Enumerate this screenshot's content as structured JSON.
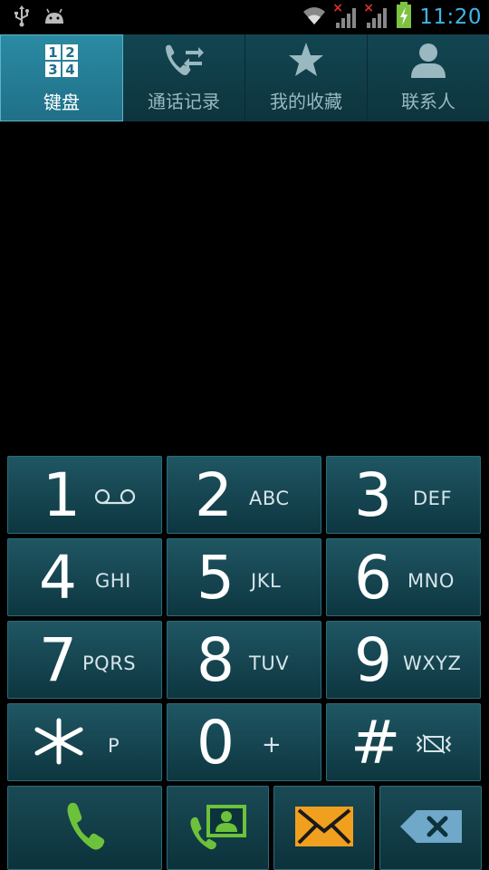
{
  "status": {
    "time": "11:20",
    "icons": [
      "usb-icon",
      "android-icon",
      "wifi-icon",
      "signal-no-sim-icon",
      "signal-no-sim-icon",
      "battery-charging-icon"
    ]
  },
  "tabs": [
    {
      "label": "键盘",
      "icon": "keypad-icon",
      "active": true
    },
    {
      "label": "通话记录",
      "icon": "call-log-icon",
      "active": false
    },
    {
      "label": "我的收藏",
      "icon": "star-icon",
      "active": false
    },
    {
      "label": "联系人",
      "icon": "person-icon",
      "active": false
    }
  ],
  "keypad": {
    "k1": {
      "digit": "1",
      "letters": ""
    },
    "k2": {
      "digit": "2",
      "letters": "ABC"
    },
    "k3": {
      "digit": "3",
      "letters": "DEF"
    },
    "k4": {
      "digit": "4",
      "letters": "GHI"
    },
    "k5": {
      "digit": "5",
      "letters": "JKL"
    },
    "k6": {
      "digit": "6",
      "letters": "MNO"
    },
    "k7": {
      "digit": "7",
      "letters": "PQRS"
    },
    "k8": {
      "digit": "8",
      "letters": "TUV"
    },
    "k9": {
      "digit": "9",
      "letters": "WXYZ"
    },
    "kstar": {
      "digit": "*",
      "letters": "P"
    },
    "k0": {
      "digit": "0",
      "letters": "+"
    },
    "khash": {
      "digit": "#",
      "letters": ""
    }
  },
  "colors": {
    "accent": "#3fb6e6",
    "call_green": "#6cc23a",
    "message_orange": "#f0a01e",
    "delete_blue": "#6fa8c8",
    "key_bg": "#174a56"
  }
}
